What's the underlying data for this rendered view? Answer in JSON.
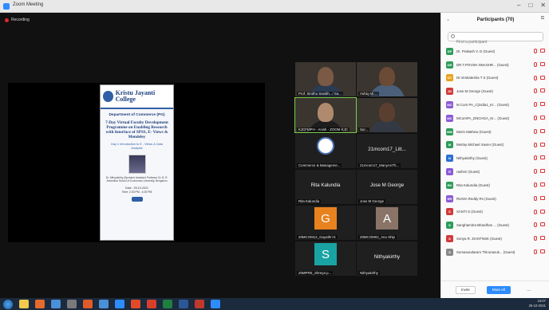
{
  "window": {
    "title": "Zoom Meeting",
    "controls": [
      "–",
      "□",
      "✕"
    ]
  },
  "recording": {
    "label": "Recording"
  },
  "shared_poster": {
    "college": "Kristu Jayanti College",
    "department": "Department of Commerce (PG)",
    "programme": "7-Day Virtual Faculty Development Programme on Enabling Research with Interface of SPSS, E- Views & Mendeley",
    "day": "Day 1 Introduction to E - Views & Data Analysis",
    "speaker": "Dr. Nithyakirthy (Speaker) Assistant Professor Dr. B. R. Ambedkar School of Economics University, Bengaluru",
    "date": "Date : 25-10-2021",
    "time": "Time: 2.00 PM - 4.00 PM"
  },
  "tiles": [
    {
      "name": "Prof. Sindhu Sasidh.../ Sa...",
      "kind": "video"
    },
    {
      "name": "Ashiq Ali ...",
      "kind": "video"
    },
    {
      "name": "KJCFMPH - Anish - ZOOM KJC",
      "kind": "video",
      "active": true
    },
    {
      "name": "Sur...",
      "kind": "video"
    },
    {
      "name": "Commerce & Manageme...",
      "kind": "logo"
    },
    {
      "name": "21mcom17_Litt...",
      "label": "21mcom17_Litt...",
      "sub": "21mcom17_ManyAnTh...",
      "kind": "text"
    },
    {
      "name": "Rita Kalundia",
      "label": "Rita Kalundia",
      "kind": "text"
    },
    {
      "name": "Jose M George",
      "label": "Jose M George",
      "kind": "text"
    },
    {
      "name": "20MCOM12_Gayathri K",
      "letter": "G",
      "color": "#e8821e",
      "kind": "avatar"
    },
    {
      "name": "20MCOM02_Anu Ship",
      "letter": "A",
      "color": "#8a7468",
      "kind": "avatar"
    },
    {
      "name": "20MPRE_Shreya p...",
      "letter": "S",
      "color": "#1aa3a3",
      "kind": "avatar"
    },
    {
      "name": "Nithyakirthy",
      "label": "Nithyakirthy",
      "kind": "text"
    }
  ],
  "participants_panel": {
    "title": "Participants (70)",
    "search_placeholder": "Find a participant",
    "participants": [
      {
        "initials": "DP",
        "color": "#2e9c5b",
        "name": "Dr. Prakash V. D (Guest)"
      },
      {
        "initials": "DR",
        "color": "#2e9c5b",
        "name": "DR.T.POVSH.NNASHR... (Guest)"
      },
      {
        "initials": "DT",
        "color": "#e8a21e",
        "name": "Dr.Venkatesha T S (Guest)"
      },
      {
        "initials": "JG",
        "color": "#d33a3a",
        "name": "Jose M George (Guest)"
      },
      {
        "initials": "MC",
        "color": "#8a5bd6",
        "name": "M Com PA_C(india1_Kr... (Guest)"
      },
      {
        "initials": "MC",
        "color": "#8a5bd6",
        "name": "MComPA_DNCHGA_Kr... (Guest)"
      },
      {
        "initials": "MM",
        "color": "#2e9c5b",
        "name": "Merin Mathew (Guest)"
      },
      {
        "initials": "M",
        "color": "#2e9c5b",
        "name": "Merlay Michael Xavier (Guest)"
      },
      {
        "initials": "N",
        "color": "#2d6fd6",
        "name": "Nithyakirthy (Guest)"
      },
      {
        "initials": "R",
        "color": "#8a5bd6",
        "name": "rashmi (Guest)"
      },
      {
        "initials": "RK",
        "color": "#2e9c5b",
        "name": "Rita Kalundia (Guest)"
      },
      {
        "initials": "RR",
        "color": "#8a5bd6",
        "name": "RUNIA Reddy Rs (Guest)"
      },
      {
        "initials": "S",
        "color": "#d33a3a",
        "name": "SANTI S (Guest)"
      },
      {
        "initials": "S",
        "color": "#2e9c5b",
        "name": "Sanghamitra Bhardhan ... (Guest)"
      },
      {
        "initials": "S",
        "color": "#d33a3a",
        "name": "Sonya R. ZIANTNSK (Guest)"
      },
      {
        "initials": "S",
        "color": "#888888",
        "name": "Somasundaram Thirunavuk... (Guest)"
      }
    ],
    "invite_label": "Invite",
    "mute_all_label": "Mute All",
    "more_label": "..."
  },
  "taskbar": {
    "icon_colors": [
      "#f2c94c",
      "#e46b2c",
      "#4a90d9",
      "#7a7a7a",
      "#e05a2a",
      "#4a90d9",
      "#2d8cff",
      "#e24a2a",
      "#d6402a",
      "#1f7f3f",
      "#2b5797",
      "#c0392b",
      "#2d8cff"
    ],
    "time": "15:07",
    "date": "25-10-2021"
  }
}
